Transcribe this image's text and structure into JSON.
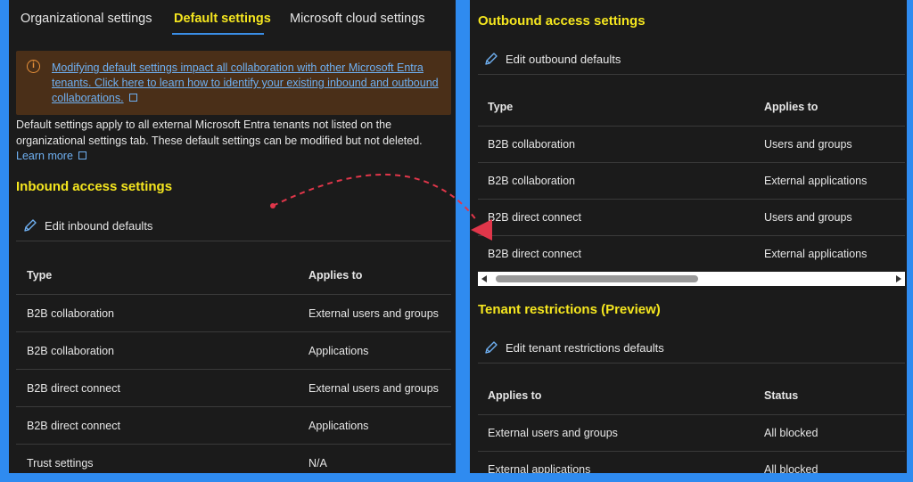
{
  "tabs": [
    {
      "label": "Organizational settings"
    },
    {
      "label": "Default settings"
    },
    {
      "label": "Microsoft cloud settings"
    }
  ],
  "banner": {
    "text": "Modifying default settings impact all collaboration with other Microsoft Entra tenants. Click here to learn how to identify your existing inbound and outbound collaborations."
  },
  "description": "Default settings apply to all external Microsoft Entra tenants not listed on the organizational settings tab. These default settings can be modified but not deleted.",
  "learn_more": "Learn more",
  "inbound": {
    "title": "Inbound access settings",
    "edit_label": "Edit inbound defaults",
    "headers": [
      "Type",
      "Applies to"
    ],
    "rows": [
      [
        "B2B collaboration",
        "External users and groups"
      ],
      [
        "B2B collaboration",
        "Applications"
      ],
      [
        "B2B direct connect",
        "External users and groups"
      ],
      [
        "B2B direct connect",
        "Applications"
      ],
      [
        "Trust settings",
        "N/A"
      ]
    ]
  },
  "outbound": {
    "title": "Outbound access settings",
    "edit_label": "Edit outbound defaults",
    "headers": [
      "Type",
      "Applies to"
    ],
    "rows": [
      [
        "B2B collaboration",
        "Users and groups"
      ],
      [
        "B2B collaboration",
        "External applications"
      ],
      [
        "B2B direct connect",
        "Users and groups"
      ],
      [
        "B2B direct connect",
        "External applications"
      ]
    ]
  },
  "tenant_restrictions": {
    "title": "Tenant restrictions (Preview)",
    "edit_label": "Edit tenant restrictions defaults",
    "headers": [
      "Applies to",
      "Status"
    ],
    "rows": [
      [
        "External users and groups",
        "All blocked"
      ],
      [
        "External applications",
        "All blocked"
      ]
    ]
  },
  "colors": {
    "background": "#2f8bf0",
    "panel": "#1b1b1b",
    "highlight": "#f5e61f",
    "link": "#6fb0f2",
    "banner": "#4a2f18",
    "annotation_arrow": "#e0364a"
  }
}
